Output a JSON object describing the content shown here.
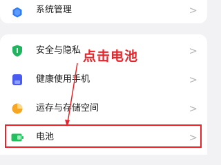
{
  "settings": {
    "items": [
      {
        "label": "系统管理",
        "icon": "hexagon-icon",
        "color": "#2f7bf5"
      },
      {
        "label": "安全与隐私",
        "icon": "shield-icon",
        "color": "#21b35f"
      },
      {
        "label": "健康使用手机",
        "icon": "hourglass-icon",
        "color": "#4a5cf0"
      },
      {
        "label": "运存与存储空间",
        "icon": "pie-icon",
        "color": "#f5a623"
      },
      {
        "label": "电池",
        "icon": "battery-icon",
        "color": "#22c05e"
      }
    ],
    "chevron": ">"
  },
  "annotation": {
    "text": "点击电池",
    "color": "#e8242a"
  }
}
